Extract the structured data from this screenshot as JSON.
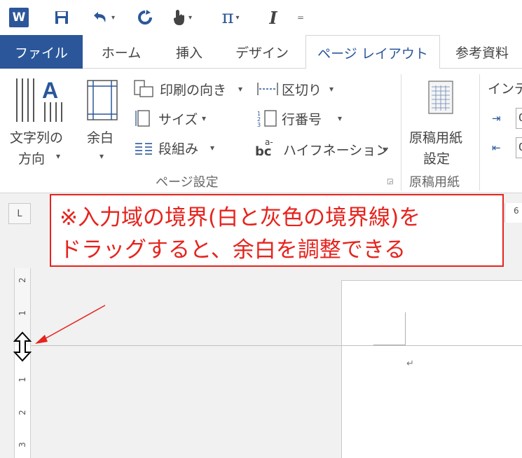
{
  "quick_access": {
    "word_logo": "W",
    "save_icon": "save-icon",
    "undo_icon": "undo-icon",
    "repeat_icon": "repeat-icon",
    "touch_icon": "touch-mode-icon",
    "equation_symbol": "π",
    "italic_symbol": "I",
    "customize_symbol": "="
  },
  "tabs": [
    {
      "label": "ファイル"
    },
    {
      "label": "ホーム"
    },
    {
      "label": "挿入"
    },
    {
      "label": "デザイン"
    },
    {
      "label": "ページ レイアウト"
    },
    {
      "label": "参考資料"
    }
  ],
  "ribbon": {
    "text_direction": {
      "line1": "文字列の",
      "line2": "方向"
    },
    "margins": {
      "label": "余白"
    },
    "orientation": {
      "label": "印刷の向き"
    },
    "size": {
      "label": "サイズ"
    },
    "columns": {
      "label": "段組み"
    },
    "breaks": {
      "label": "区切り"
    },
    "line_numbers": {
      "label": "行番号"
    },
    "hyphenation": {
      "label": "ハイフネーション",
      "icon_text": "bc",
      "icon_sup": "a-"
    },
    "page_setup_group": "ページ設定",
    "manuscript": {
      "line1": "原稿用紙",
      "line2": "設定"
    },
    "manuscript_group": "原稿用紙",
    "indent_label": "インデ",
    "indent_values": [
      "0",
      "0"
    ]
  },
  "ruler": {
    "tab_selector": "L",
    "h_number": "6",
    "v_numbers": [
      "2",
      "1",
      "1",
      "2",
      "3"
    ]
  },
  "callout": {
    "line1": "※入力域の境界(白と灰色の境界線)を",
    "line2": "ドラッグすると、余白を調整できる"
  },
  "document": {
    "paragraph_mark": "↵"
  },
  "colors": {
    "accent": "#2b579a",
    "callout": "#e6231d"
  }
}
